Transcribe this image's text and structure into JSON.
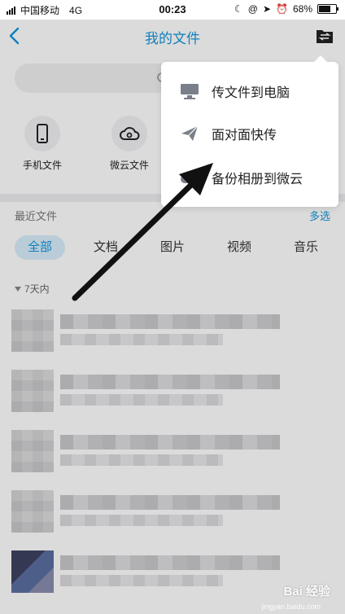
{
  "status_bar": {
    "carrier": "中国移动",
    "network": "4G",
    "time": "00:23",
    "battery": "68%",
    "battery_level": 0.68
  },
  "nav": {
    "title": "我的文件"
  },
  "quick_entries": [
    {
      "label": "手机文件",
      "icon": "phone-icon"
    },
    {
      "label": "微云文件",
      "icon": "cloud-icon"
    }
  ],
  "recent": {
    "title": "最近文件",
    "action": "多选"
  },
  "filters": [
    {
      "label": "全部",
      "active": true
    },
    {
      "label": "文档",
      "active": false
    },
    {
      "label": "图片",
      "active": false
    },
    {
      "label": "视频",
      "active": false
    },
    {
      "label": "音乐",
      "active": false
    }
  ],
  "group": {
    "label": "7天内"
  },
  "menu": {
    "items": [
      {
        "label": "传文件到电脑",
        "icon": "monitor-icon"
      },
      {
        "label": "面对面快传",
        "icon": "paper-plane-icon"
      },
      {
        "label": "备份相册到微云",
        "icon": "cloud-upload-icon"
      }
    ]
  },
  "watermark": {
    "text": "Bai 经验",
    "subtext": "jingyan.baidu.com"
  },
  "colors": {
    "accent": "#1296db",
    "arrow": "#111111"
  }
}
